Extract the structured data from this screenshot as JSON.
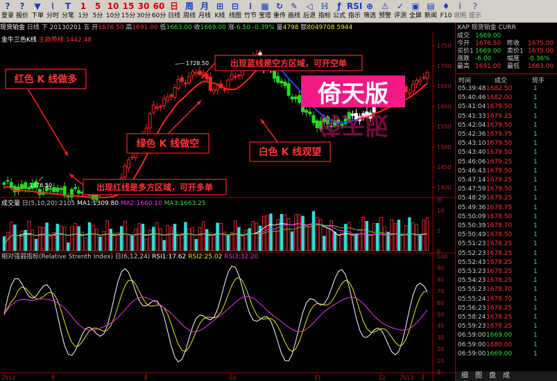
{
  "toolbar": [
    {
      "label": "登录",
      "icon": "?"
    },
    {
      "label": "报价",
      "icon": "?"
    },
    {
      "label": "下单",
      "icon": "▼"
    },
    {
      "label": "分时",
      "icon": "⌇"
    },
    {
      "label": "分笔",
      "icon": "T"
    },
    {
      "label": "1分",
      "icon": "1"
    },
    {
      "label": "5分",
      "icon": "5"
    },
    {
      "label": "10分",
      "icon": "10"
    },
    {
      "label": "15分",
      "icon": "15"
    },
    {
      "label": "30分",
      "icon": "30"
    },
    {
      "label": "60分",
      "icon": "60"
    },
    {
      "label": "日线",
      "icon": "日"
    },
    {
      "label": "周线",
      "icon": "周"
    },
    {
      "label": "月线",
      "icon": "月"
    },
    {
      "label": "K线",
      "icon": "⊞"
    },
    {
      "label": "线图",
      "icon": "⊟"
    },
    {
      "label": "竹节",
      "icon": "⁞"
    },
    {
      "label": "宝塔",
      "icon": "▦"
    },
    {
      "label": "重传",
      "icon": "↻"
    },
    {
      "label": "画线",
      "icon": "✎"
    },
    {
      "label": "后退",
      "icon": "◁"
    },
    {
      "label": "指标",
      "icon": "ℍ"
    },
    {
      "label": "公式",
      "icon": "ƒ"
    },
    {
      "label": "指示",
      "icon": "RSI"
    },
    {
      "label": "筛选",
      "icon": "⊕"
    },
    {
      "label": "预警",
      "icon": "⚠"
    },
    {
      "label": "评测",
      "icon": "✓"
    },
    {
      "label": "全屏",
      "icon": "▣"
    },
    {
      "label": "新闻",
      "icon": "▤"
    },
    {
      "label": "F10",
      "icon": "♦"
    },
    {
      "label": "说明",
      "icon": "i"
    },
    {
      "label": "提示",
      "icon": "?"
    }
  ],
  "info": {
    "name": "现货铂金",
    "period": "日线",
    "dir": "下",
    "date": "20130201",
    "weekday": "五",
    "open_label": "开",
    "open": "1676.50",
    "high_label": "高",
    "high": "1691.00",
    "low_label": "低",
    "low": "1663.00",
    "close_label": "收",
    "close": "1669.00",
    "chg_label": "涨",
    "chg": "-6.50",
    "pct": "-0.39%",
    "vol_label": "量",
    "vol": "4798",
    "amt_label": "额",
    "amt": "8049708 5944"
  },
  "indicator_title": "金牛三色K线",
  "indicator_value": "主趋势线:1442.48",
  "annotations": {
    "red": "红色 K 线做多",
    "green": "绿色 K 线做空",
    "white": "白色 K 线观望",
    "blue_zone": "出现蓝线是空方区域，可开空单",
    "red_zone": "出现红线是多方区域，可开多单",
    "watermark": "倚天版"
  },
  "price_marks": {
    "high": "1728.50",
    "low": "1376.50"
  },
  "volume": {
    "title": "成交量",
    "params": "日(5,10,20):2105",
    "ma1": "MA1:1309.80",
    "ma2": "MA2:1660.10",
    "ma3": "MA3:1663.25"
  },
  "rsi": {
    "title": "相对强弱指标(Relative Strenth Index)",
    "params": "日(6,12,24)",
    "rsi1": "RSI1:17.62",
    "rsi2": "RSI2:25.02",
    "rsi3": "RSI3:32.20"
  },
  "axes": {
    "price_ticks": [
      "1750",
      "1700",
      "1650",
      "1600",
      "1550",
      "1500",
      "1450",
      "1400"
    ],
    "vol_ticks": [
      "10",
      "5",
      "0"
    ],
    "vol_unit": "百",
    "rsi_ticks": [
      "100",
      "90",
      "80",
      "70",
      "60",
      "50",
      "40",
      "30",
      "20",
      "10",
      "0"
    ],
    "dates": [
      "2012",
      "8",
      "9",
      "10",
      "11",
      "12",
      "2013",
      "2"
    ]
  },
  "quote": {
    "header": "XAP 现货铂金 CURR",
    "rows": [
      {
        "l1": "成交",
        "v1": "1669.00",
        "l2": "",
        "v2": ""
      },
      {
        "l1": "今开",
        "v1": "1676.50",
        "l2": "昨收",
        "v2": "1675.00"
      },
      {
        "l1": "买价1",
        "v1": "1669.00",
        "l2": "卖价1",
        "v2": "1675.00"
      },
      {
        "l1": "涨跌",
        "v1": "-6.00",
        "l2": "幅度",
        "v2": "-0.36%"
      },
      {
        "l1": "最高",
        "v1": "1691.00",
        "l2": "最低",
        "v2": "1663.00"
      }
    ]
  },
  "ticks": {
    "headers": [
      "时间",
      "成交",
      "现手"
    ],
    "rows": [
      {
        "t": "05:39:48",
        "p": "1682.50",
        "q": "1",
        "c": "#ff3333"
      },
      {
        "t": "05:40:46",
        "p": "1682.00",
        "q": "1",
        "c": "#ff3333"
      },
      {
        "t": "05:41:04",
        "p": "1679.50",
        "q": "1",
        "c": "#ff3333"
      },
      {
        "t": "05:41:33",
        "p": "1679.25",
        "q": "1",
        "c": "#ff3333"
      },
      {
        "t": "05:42:04",
        "p": "1679.50",
        "q": "1",
        "c": "#ff3333"
      },
      {
        "t": "05:42:36",
        "p": "1679.75",
        "q": "1",
        "c": "#ff3333"
      },
      {
        "t": "05:43:10",
        "p": "1679.50",
        "q": "1",
        "c": "#ff3333"
      },
      {
        "t": "05:43:40",
        "p": "1679.50",
        "q": "1",
        "c": "#ff3333"
      },
      {
        "t": "05:46:06",
        "p": "1679.25",
        "q": "1",
        "c": "#ff3333"
      },
      {
        "t": "05:46:43",
        "p": "1679.50",
        "q": "1",
        "c": "#ff3333"
      },
      {
        "t": "05:47:14",
        "p": "1679.25",
        "q": "1",
        "c": "#ff3333"
      },
      {
        "t": "05:47:59",
        "p": "1679.50",
        "q": "1",
        "c": "#ff3333"
      },
      {
        "t": "05:48:29",
        "p": "1679.25",
        "q": "1",
        "c": "#ff3333"
      },
      {
        "t": "05:49:36",
        "p": "1678.75",
        "q": "1",
        "c": "#ff3333"
      },
      {
        "t": "05:50:09",
        "p": "1678.50",
        "q": "1",
        "c": "#ff3333"
      },
      {
        "t": "05:50:39",
        "p": "1678.70",
        "q": "1",
        "c": "#ff3333"
      },
      {
        "t": "05:50:49",
        "p": "1678.50",
        "q": "1",
        "c": "#ff3333"
      },
      {
        "t": "05:51:23",
        "p": "1678.25",
        "q": "1",
        "c": "#ff3333"
      },
      {
        "t": "05:52:23",
        "p": "1678.25",
        "q": "1",
        "c": "#ff3333"
      },
      {
        "t": "05:52:43",
        "p": "1678.25",
        "q": "1",
        "c": "#ff3333"
      },
      {
        "t": "05:53:23",
        "p": "1678.25",
        "q": "1",
        "c": "#ff3333"
      },
      {
        "t": "05:54:23",
        "p": "1678.25",
        "q": "1",
        "c": "#ff3333"
      },
      {
        "t": "05:55:23",
        "p": "1678.70",
        "q": "1",
        "c": "#ff3333"
      },
      {
        "t": "05:55:24",
        "p": "1678.70",
        "q": "1",
        "c": "#ff3333"
      },
      {
        "t": "05:56:23",
        "p": "1678.25",
        "q": "1",
        "c": "#ff3333"
      },
      {
        "t": "05:58:24",
        "p": "1678.25",
        "q": "1",
        "c": "#ff3333"
      },
      {
        "t": "05:59:23",
        "p": "1678.25",
        "q": "1",
        "c": "#ff3333"
      },
      {
        "t": "06:59:00",
        "p": "1669.00",
        "q": "1",
        "c": "#33dd33"
      },
      {
        "t": "06:59:00",
        "p": "1680.00",
        "q": "1",
        "c": "#ff3333"
      },
      {
        "t": "06:59:00",
        "p": "1669.00",
        "q": "1",
        "c": "#33dd33"
      }
    ]
  },
  "right_tabs": [
    "细",
    "图",
    "盘",
    "成"
  ]
}
